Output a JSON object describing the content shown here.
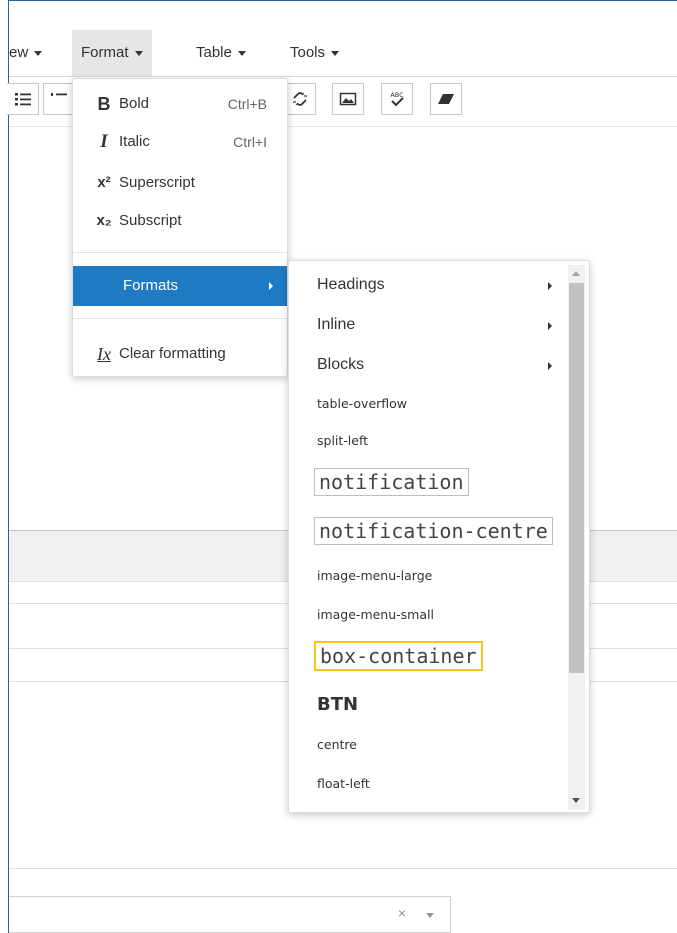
{
  "menubar": {
    "items": [
      {
        "label": "ew"
      },
      {
        "label": "Format"
      },
      {
        "label": "Table"
      },
      {
        "label": "Tools"
      }
    ]
  },
  "toolbar": {
    "icons": [
      "bullet-list-icon",
      "numbered-list-icon",
      "unlink-icon",
      "image-icon",
      "spellcheck-icon",
      "eraser-icon"
    ],
    "spellcheck_text": "ABC"
  },
  "format_menu": {
    "items": [
      {
        "icon_glyph": "B",
        "label": "Bold",
        "shortcut": "Ctrl+B"
      },
      {
        "icon_glyph": "I",
        "label": "Italic",
        "shortcut": "Ctrl+I"
      },
      {
        "icon_glyph": "x²",
        "label": "Superscript",
        "shortcut": ""
      },
      {
        "icon_glyph": "x₂",
        "label": "Subscript",
        "shortcut": ""
      }
    ],
    "formats_label": "Formats",
    "clear_glyph": "Ix",
    "clear_label": "Clear formatting",
    "accent_color": "#1f7ac4"
  },
  "formats_submenu": {
    "items": [
      {
        "label": "Headings"
      },
      {
        "label": "Inline"
      },
      {
        "label": "Blocks"
      },
      {
        "label": "table-overflow"
      },
      {
        "label": "split-left"
      },
      {
        "label": "notification"
      },
      {
        "label": "notification-centre"
      },
      {
        "label": "image-menu-large"
      },
      {
        "label": "image-menu-small"
      },
      {
        "label": "box-container"
      },
      {
        "label": "BTN"
      },
      {
        "label": "centre"
      },
      {
        "label": "float-left"
      }
    ],
    "highlight_color": "#f5c518"
  },
  "select_field": {
    "clear_glyph": "×"
  }
}
